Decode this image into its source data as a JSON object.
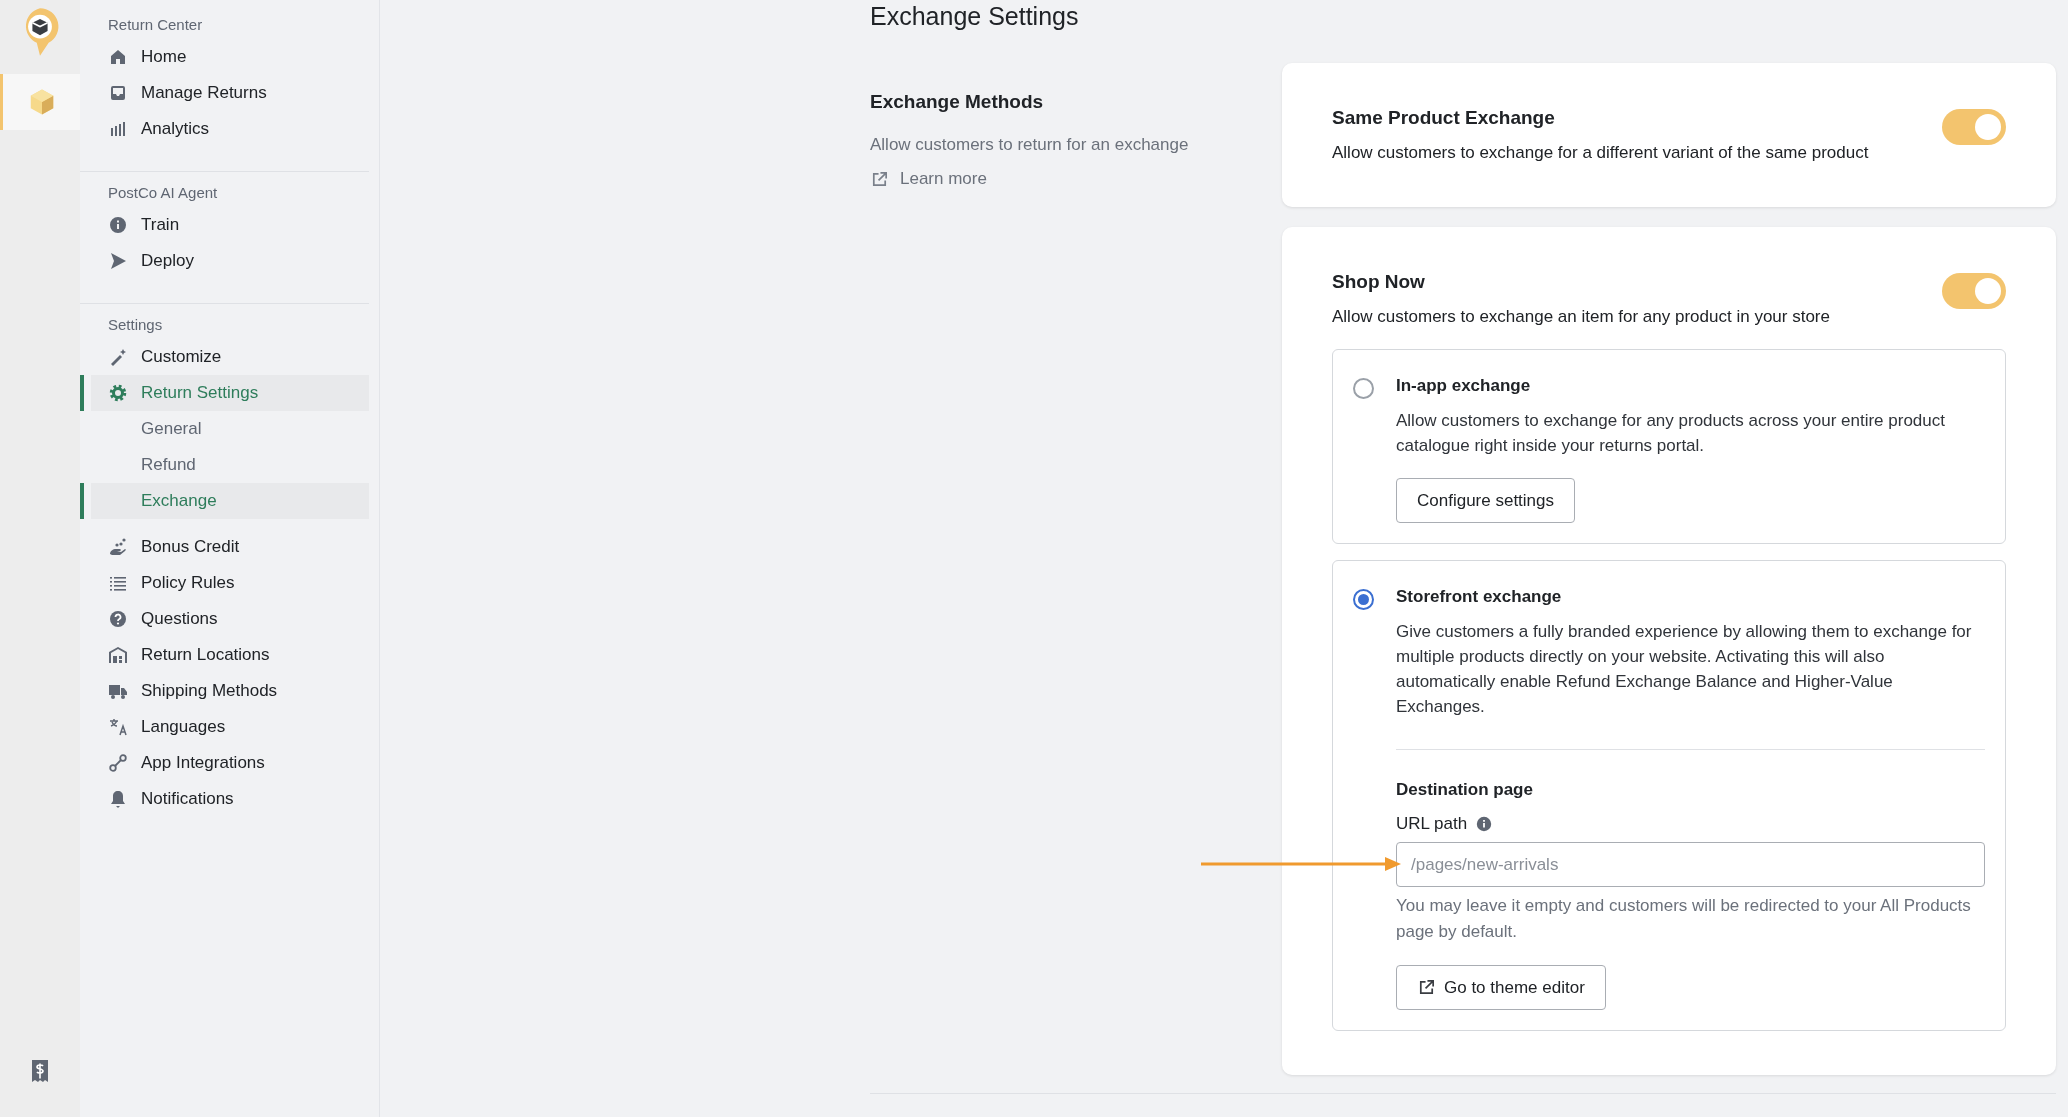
{
  "rail": [
    {
      "selected": true
    },
    {
      "selected": false
    }
  ],
  "sidebar": {
    "sections": [
      {
        "title": "Return Center",
        "items": [
          {
            "label": "Home",
            "selected": false
          },
          {
            "label": "Manage Returns",
            "selected": false
          },
          {
            "label": "Analytics",
            "selected": false
          }
        ]
      },
      {
        "title": "PostCo AI Agent",
        "items": [
          {
            "label": "Train",
            "selected": false
          },
          {
            "label": "Deploy",
            "selected": false
          }
        ]
      },
      {
        "title": "Settings",
        "items": [
          {
            "label": "Customize",
            "selected": false
          },
          {
            "label": "Return Settings",
            "selected": true,
            "children": [
              {
                "label": "General",
                "selected": false
              },
              {
                "label": "Refund",
                "selected": false
              },
              {
                "label": "Exchange",
                "selected": true
              }
            ]
          },
          {
            "label": "Bonus Credit",
            "selected": false
          },
          {
            "label": "Policy Rules",
            "selected": false
          },
          {
            "label": "Questions",
            "selected": false
          },
          {
            "label": "Return Locations",
            "selected": false
          },
          {
            "label": "Shipping Methods",
            "selected": false
          },
          {
            "label": "Languages",
            "selected": false
          },
          {
            "label": "App Integrations",
            "selected": false
          },
          {
            "label": "Notifications",
            "selected": false
          }
        ]
      }
    ]
  },
  "page_title": "Exchange Settings",
  "section": {
    "title": "Exchange Methods",
    "description": "Allow customers to return for an exchange",
    "link": "Learn more"
  },
  "cards": [
    {
      "title": "Same Product Exchange",
      "description": "Allow customers to exchange for a different variant of the same product",
      "on": true
    },
    {
      "title": "Shop Now",
      "description": "Allow customers to exchange an item for any product in your store",
      "on": true,
      "options": [
        {
          "kind": "button",
          "title": "In-app exchange",
          "description": "Allow customers to exchange for any products across your entire product catalogue right inside your returns portal.",
          "selected": false,
          "button": "Configure settings"
        },
        {
          "kind": "destination",
          "title": "Storefront exchange",
          "description": "Give customers a fully branded experience by allowing them to exchange for multiple products directly on your website. Activating this will also automatically enable Refund Exchange Balance and Higher-Value Exchanges.",
          "selected": true,
          "destination": {
            "heading": "Destination page",
            "field_label": "URL path",
            "placeholder": "/pages/new-arrivals",
            "help": "You may leave it empty and customers will be redirected to your All Products page by default.",
            "button": "Go to theme editor"
          }
        }
      ]
    }
  ]
}
